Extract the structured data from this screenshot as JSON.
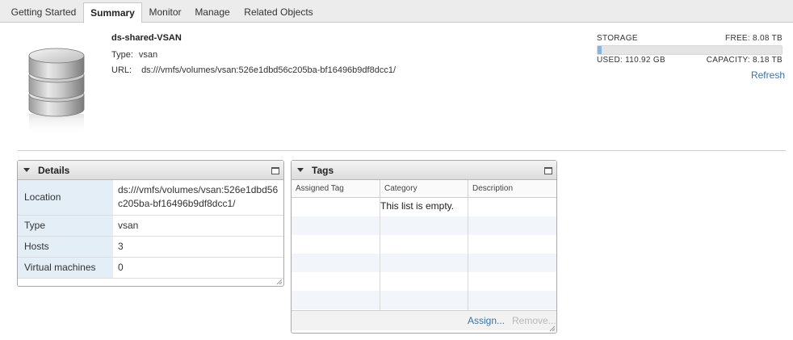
{
  "tabs": [
    {
      "label": "Getting Started",
      "active": false
    },
    {
      "label": "Summary",
      "active": true
    },
    {
      "label": "Monitor",
      "active": false
    },
    {
      "label": "Manage",
      "active": false
    },
    {
      "label": "Related Objects",
      "active": false
    }
  ],
  "datastore": {
    "name": "ds-shared-VSAN",
    "type_label": "Type:",
    "type_value": "vsan",
    "url_label": "URL:",
    "url_value": "ds:///vmfs/volumes/vsan:526e1dbd56c205ba-bf16496b9df8dcc1/",
    "icon": "database-icon"
  },
  "storage": {
    "label": "STORAGE",
    "free": "FREE: 8.08 TB",
    "used": "USED: 110.92 GB",
    "capacity": "CAPACITY: 8.18 TB",
    "used_fraction": 0.013,
    "fill_color": "#8ab4d8",
    "refresh": "Refresh"
  },
  "details": {
    "title": "Details",
    "rows": [
      {
        "key": "Location",
        "value": "ds:///vmfs/volumes/vsan:526e1dbd56c205ba-bf16496b9df8dcc1/"
      },
      {
        "key": "Type",
        "value": "vsan"
      },
      {
        "key": "Hosts",
        "value": "3"
      },
      {
        "key": "Virtual machines",
        "value": "0"
      }
    ]
  },
  "tags": {
    "title": "Tags",
    "columns": [
      "Assigned Tag",
      "Category",
      "Description"
    ],
    "empty_message": "This list is empty.",
    "assign": "Assign...",
    "remove": "Remove..."
  },
  "colors": {
    "link": "#3b73a6",
    "key_cell_bg": "#e4eef7"
  }
}
